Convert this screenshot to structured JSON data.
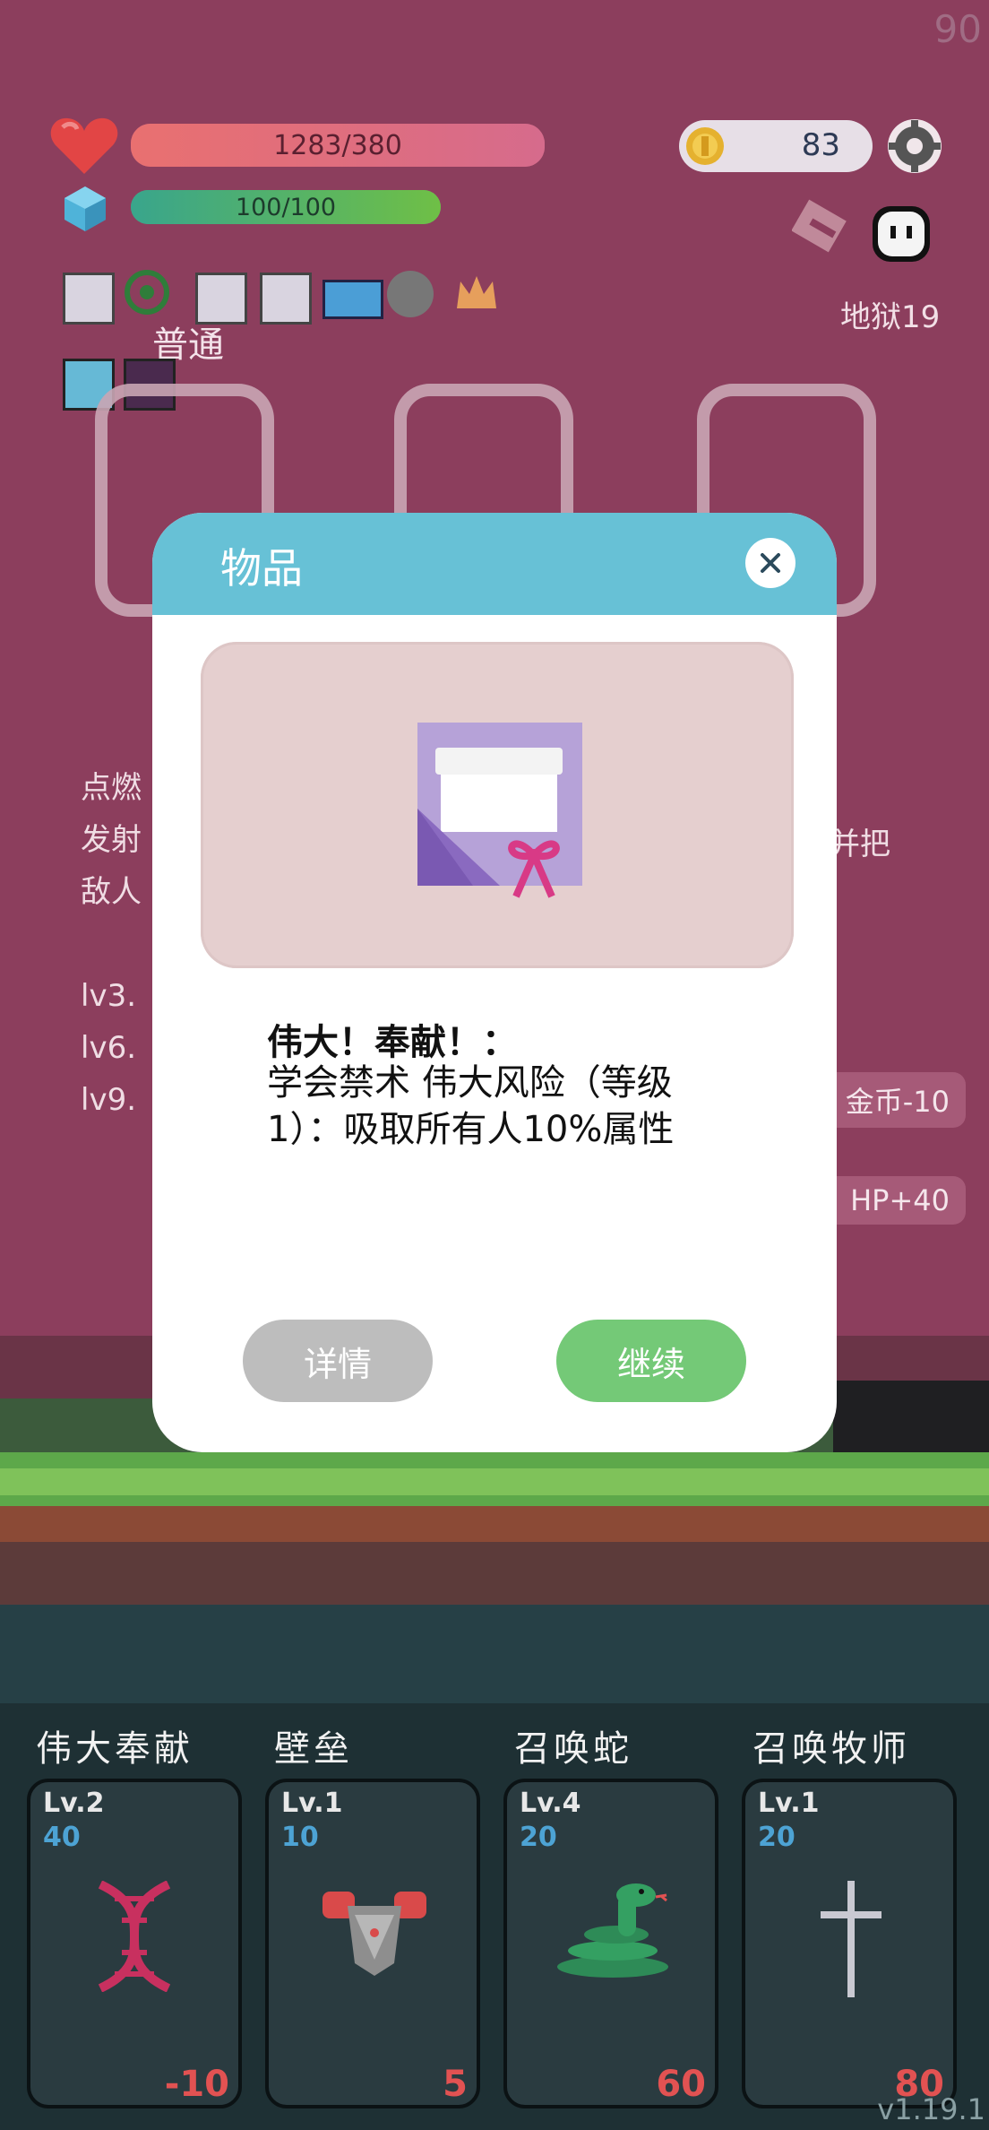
{
  "fps": "90",
  "hud": {
    "hp": {
      "text": "1283/380",
      "fill": 1.0
    },
    "mp": {
      "text": "100/100",
      "fill": 1.0
    },
    "coins": "83",
    "level": "地狱19",
    "difficulty": "普通"
  },
  "background_text": {
    "lines": [
      "点燃",
      "发射",
      "敌人",
      "",
      "lv3.",
      "lv6.",
      "lv9."
    ],
    "right_fragment": "并把",
    "gold_cost_label": "金币-10",
    "hp_bonus_label": "HP+40"
  },
  "dialog": {
    "title": "物品",
    "item_name": "伟大！奉献！：",
    "item_desc": "学会禁术 伟大风险（等级1）：吸取所有人10%属性",
    "details_label": "详情",
    "continue_label": "继续"
  },
  "skills": [
    {
      "name": "伟大奉献",
      "lv": "Lv.2",
      "cost": "40",
      "value": "-10",
      "icon": "dna-icon"
    },
    {
      "name": "壁垒",
      "lv": "Lv.1",
      "cost": "10",
      "value": "5",
      "icon": "armor-icon"
    },
    {
      "name": "召唤蛇",
      "lv": "Lv.4",
      "cost": "20",
      "value": "60",
      "icon": "snake-icon"
    },
    {
      "name": "召唤牧师",
      "lv": "Lv.1",
      "cost": "20",
      "value": "80",
      "icon": "cross-icon"
    }
  ],
  "version": "v1.19.1",
  "colors": {
    "accent": "#67c1d6",
    "continue": "#74c977",
    "details": "#bdbdbd",
    "cost": "#4da3d4",
    "value": "#e25252"
  }
}
